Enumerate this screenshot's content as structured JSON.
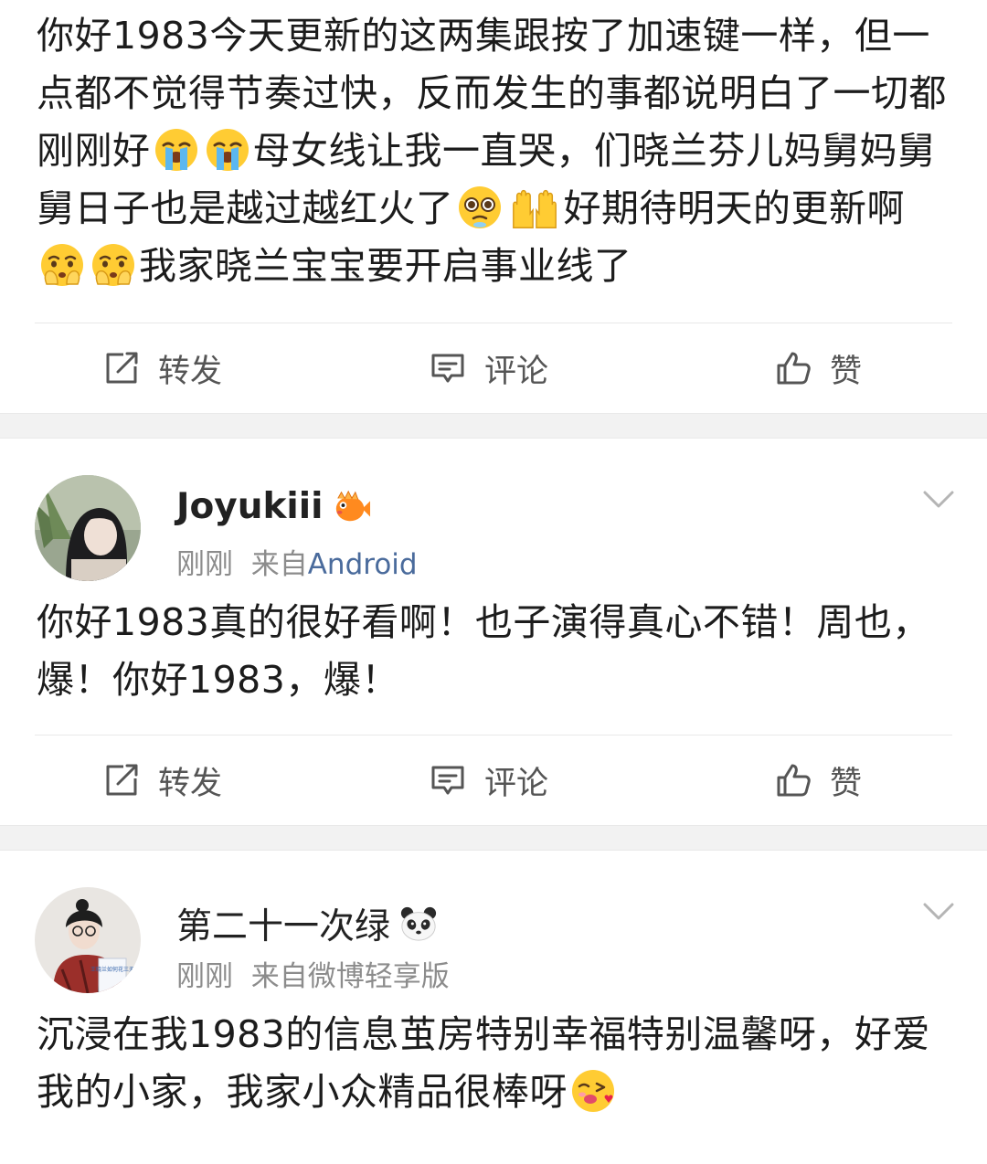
{
  "post1": {
    "segments": [
      "你好1983今天更新的这两集跟按了加速键一样，但一点都不觉得节奏过快，反而发生的事都说明白了一切都刚刚好",
      "母女线让我一直哭，们晓兰芬儿妈舅妈舅舅日子也是越过越红火了",
      "好期待明天的更新啊",
      "我家晓兰宝宝要开启事业线了"
    ],
    "actions": {
      "repost": "转发",
      "comment": "评论",
      "like": "赞"
    }
  },
  "post2": {
    "username": "Joyukiii",
    "time": "刚刚",
    "source_prefix": "来自",
    "source": "Android",
    "text": "你好1983真的很好看啊！也子演得真心不错！周也，爆！你好1983，爆！",
    "actions": {
      "repost": "转发",
      "comment": "评论",
      "like": "赞"
    }
  },
  "post3": {
    "username": "第二十一次绿",
    "time": "刚刚",
    "source_prefix": "来自",
    "source": "微博轻享版",
    "text": "沉浸在我1983的信息茧房特别幸福特别温馨呀，好爱我的小家，我家小众精品很棒呀",
    "book_cover_text": "王晓兰如何花三天"
  },
  "icons": {
    "repost": "repost-icon",
    "comment": "comment-icon",
    "like": "thumbs-up-icon",
    "crying": "loudly-crying-face-emoji",
    "pleading": "pleading-face-emoji",
    "hands": "raising-hands-emoji",
    "holding_back_tears": "face-holding-back-tears-emoji",
    "kiss": "kissing-heart-face-emoji",
    "fish_badge": "pufferfish-badge-icon",
    "panda_badge": "panda-badge-icon",
    "chevron": "chevron-down-icon"
  },
  "colors": {
    "text": "#1c1c1c",
    "meta": "#8c8c8c",
    "source_link": "#4a6b9c",
    "action": "#555555",
    "separator": "#f2f2f2"
  }
}
